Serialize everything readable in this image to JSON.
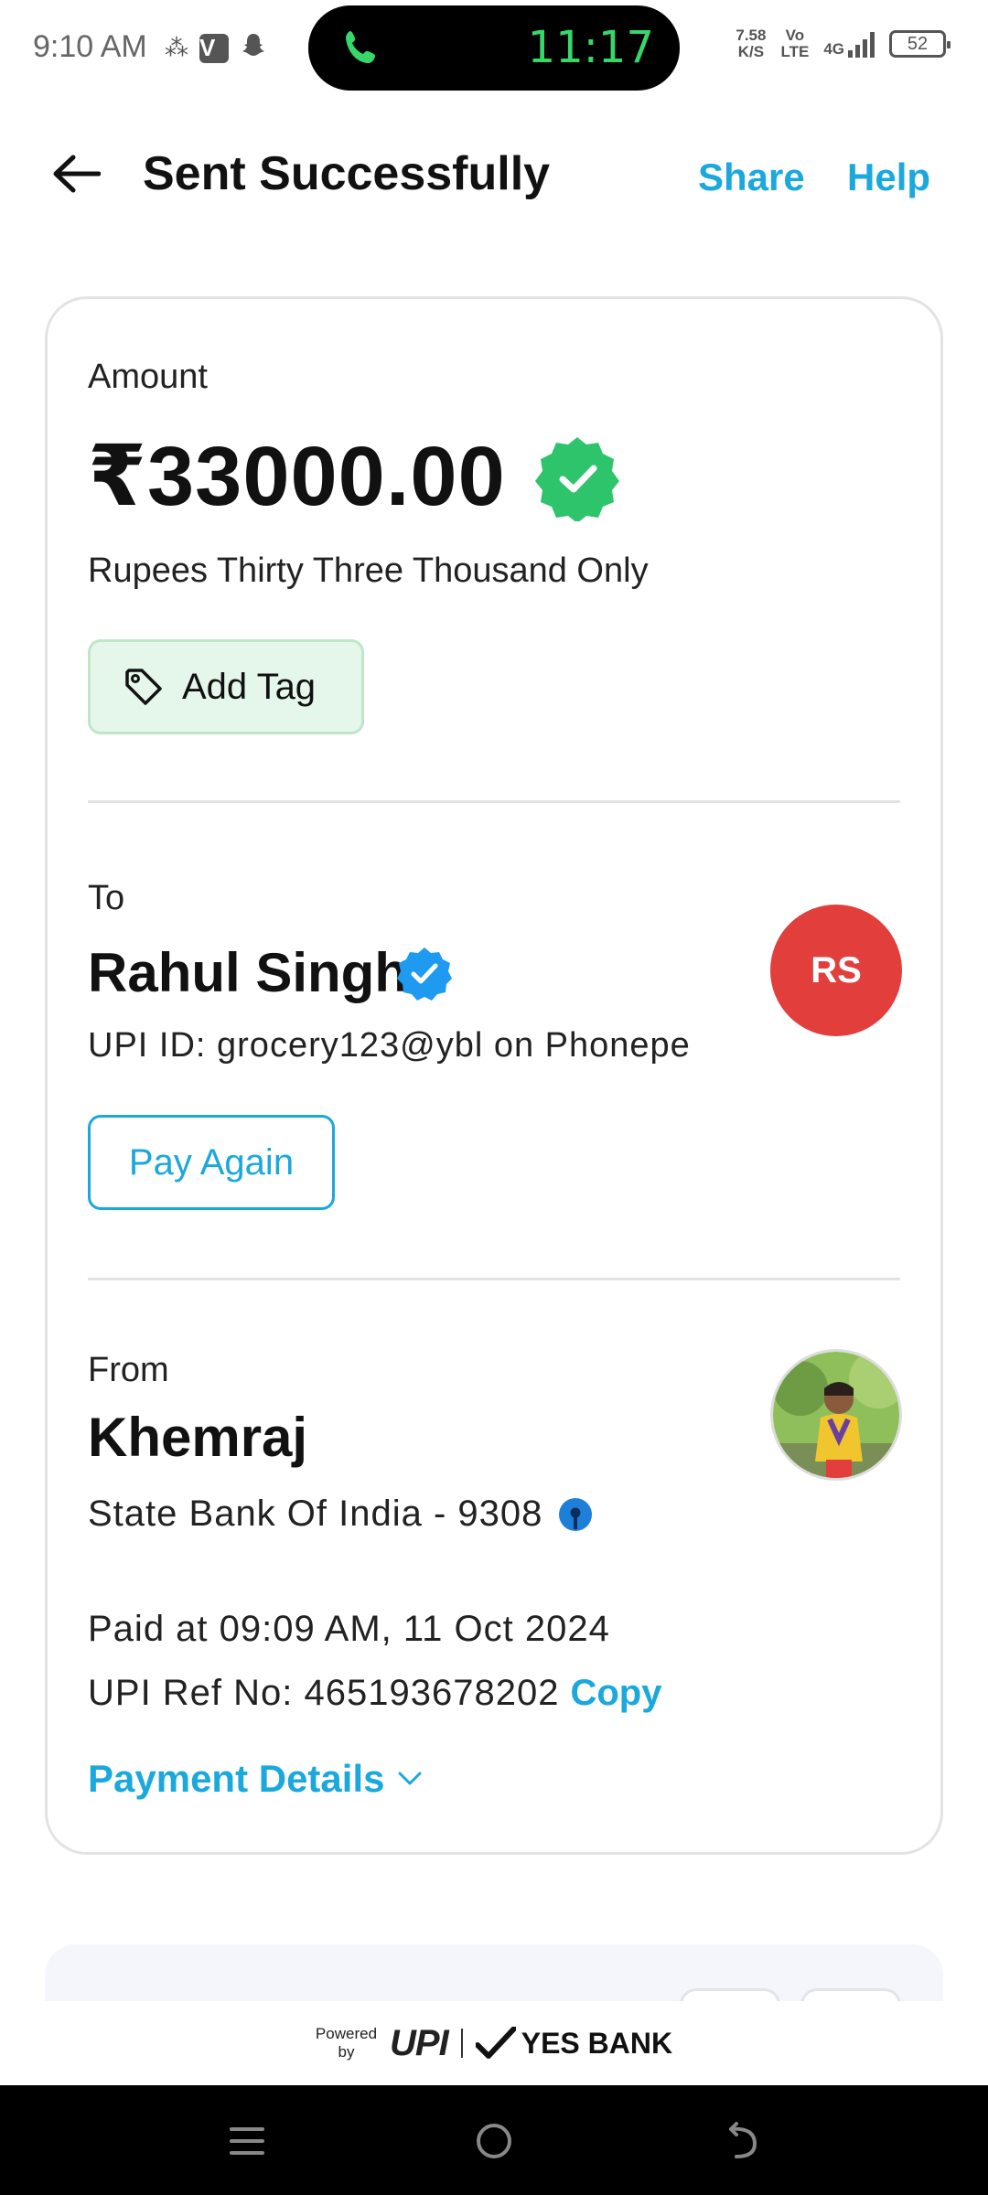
{
  "status_bar": {
    "time": "9:10 AM",
    "call_timer": "11:17",
    "net_speed_value": "7.58",
    "net_speed_unit": "K/S",
    "volte_top": "Vo",
    "volte_bottom": "LTE",
    "network": "4G",
    "battery": "52"
  },
  "header": {
    "title": "Sent Successfully",
    "share_label": "Share",
    "help_label": "Help"
  },
  "amount_section": {
    "label": "Amount",
    "amount": "₹33000.00",
    "amount_in_words": "Rupees Thirty Three Thousand Only",
    "add_tag_label": "Add Tag"
  },
  "to_section": {
    "label": "To",
    "name": "Rahul Singh",
    "upi_id": "UPI ID: grocery123@ybl on Phonepe",
    "avatar_initials": "RS",
    "pay_again_label": "Pay Again"
  },
  "from_section": {
    "label": "From",
    "name": "Khemraj",
    "bank": "State Bank Of India - 9308",
    "paid_at": "Paid at 09:09 AM, 11 Oct 2024",
    "upi_ref": "UPI Ref No: 465193678202",
    "copy_label": "Copy",
    "payment_details_label": "Payment Details"
  },
  "footer": {
    "powered_line1": "Powered",
    "powered_line2": "by",
    "upi_logo": "UPI",
    "bank_name": "YES BANK"
  },
  "colors": {
    "accent": "#1aa8dd",
    "success_green": "#2ec46b",
    "avatar_red": "#e23e3c",
    "verified_blue": "#1e9af0"
  }
}
